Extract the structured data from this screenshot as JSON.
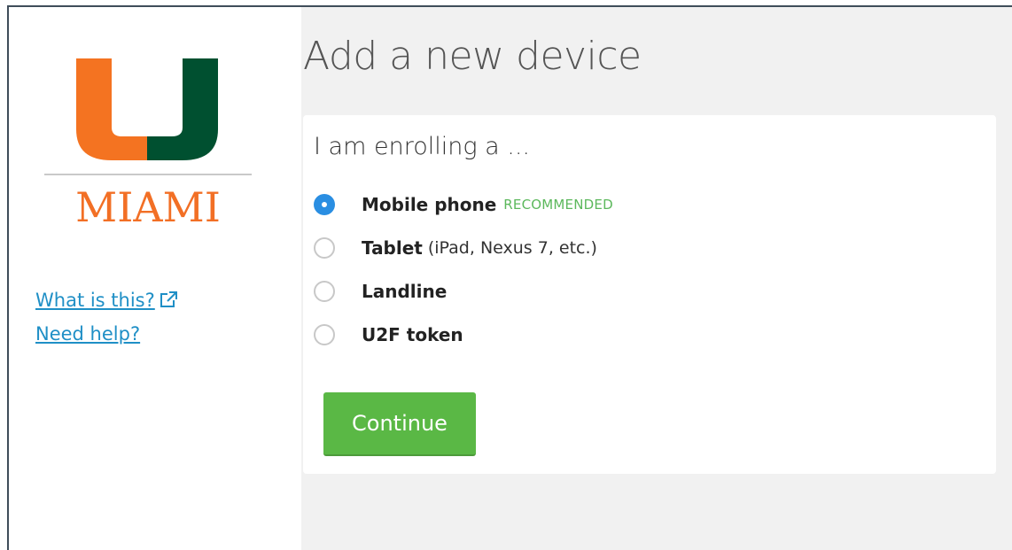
{
  "sidebar": {
    "logo_text": "MIAMI",
    "links": {
      "what_is_this": "What is this?",
      "need_help": "Need help?"
    }
  },
  "main": {
    "title": "Add a new device",
    "form": {
      "heading": "I am enrolling a ...",
      "options": [
        {
          "label": "Mobile phone",
          "hint": "",
          "badge": "RECOMMENDED",
          "selected": true
        },
        {
          "label": "Tablet",
          "hint": "(iPad, Nexus 7, etc.)",
          "badge": "",
          "selected": false
        },
        {
          "label": "Landline",
          "hint": "",
          "badge": "",
          "selected": false
        },
        {
          "label": "U2F token",
          "hint": "",
          "badge": "",
          "selected": false
        }
      ],
      "continue_label": "Continue"
    }
  },
  "colors": {
    "brand_orange": "#f26f25",
    "brand_green": "#005030",
    "link": "#1f8fc6",
    "radio_selected": "#2a8ee2",
    "recommended": "#5cb85c",
    "button": "#5ab845"
  },
  "icons": {
    "logo": "university-u-logo",
    "external_link": "external-link-icon"
  }
}
